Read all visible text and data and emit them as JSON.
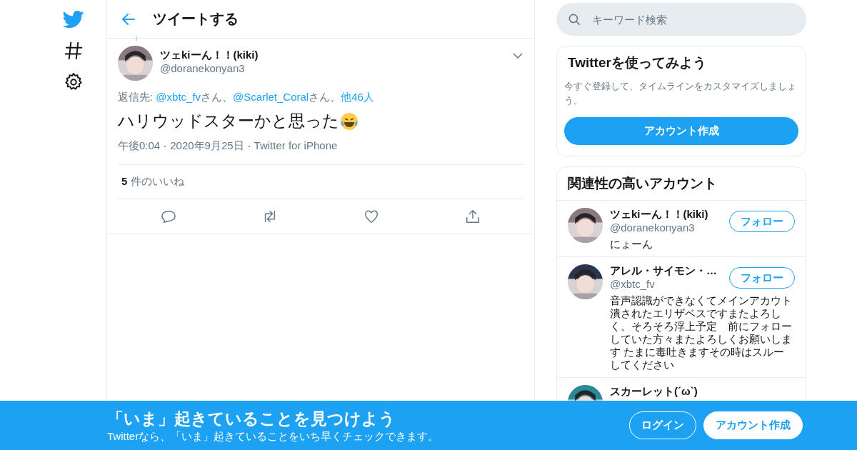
{
  "header": {
    "title": "ツイートする"
  },
  "tweet": {
    "name": "ツェkiーん！！(kiki)",
    "handle": "@doranekonyan3",
    "reply": [
      {
        "text": "返信先: ",
        "link": false
      },
      {
        "text": "@xbtc_fv",
        "link": true
      },
      {
        "text": "さん、",
        "link": false
      },
      {
        "text": "@Scarlet_Coral",
        "link": true
      },
      {
        "text": "さん、",
        "link": false
      },
      {
        "text": "他46人",
        "link": true
      }
    ],
    "text": "ハリウッドスターかと思った",
    "time": "午後0:04",
    "date": "2020年9月25日",
    "source": "Twitter for iPhone",
    "likes_count": "5",
    "likes_label": "件のいいね"
  },
  "search": {
    "placeholder": "キーワード検索"
  },
  "signup_card": {
    "title": "Twitterを使ってみよう",
    "description": "今すぐ登録して、タイムラインをカスタマイズしましょう。",
    "button": "アカウント作成"
  },
  "related": {
    "title": "関連性の高いアカウント",
    "users": [
      {
        "name": "ツェkiーん！！(kiki)",
        "handle": "@doranekonyan3",
        "bio": "にょーん",
        "follow": "フォロー"
      },
      {
        "name": "アレル・サイモン・…",
        "handle": "@xbtc_fv",
        "bio": "音声認識ができなくてメインアカウト潰されたエリザベスですまたよろしく。そろそろ浮上予定　前にフォローしていた方々またよろしくお願いします たまに毒吐きますその時はスルーしてください",
        "follow": "フォロー"
      },
      {
        "name": "スカーレット(´ω`)"
      }
    ]
  },
  "bottom_bar": {
    "headline": "「いま」起きていることを見つけよう",
    "subtext": "Twitterなら、「いま」起きていることをいち早くチェックできます。",
    "buttons": [
      {
        "label": "ログイン",
        "kind": "outline"
      },
      {
        "label": "アカウント作成",
        "kind": "filled"
      }
    ]
  }
}
